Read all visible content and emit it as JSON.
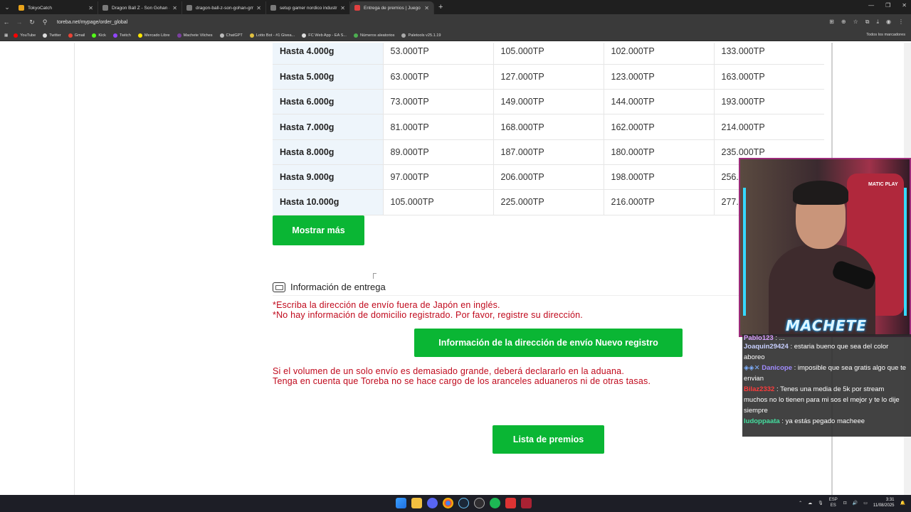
{
  "browser": {
    "tabs": [
      {
        "label": "TokyoCatch",
        "color": "#e8a31a",
        "active": false
      },
      {
        "label": "Dragon Ball Z - Son Gohan - G",
        "color": "#7a7a7a",
        "active": false
      },
      {
        "label": "dragon-ball-z-son-gohan-gm",
        "color": "#7a7a7a",
        "active": false
      },
      {
        "label": "setup gamer nordico industri",
        "color": "#7a7a7a",
        "active": false
      },
      {
        "label": "Entrega de premios | Juego de",
        "color": "#e04040",
        "active": true
      }
    ],
    "url": "toreba.net/mypage/order_global",
    "bookmarks": [
      {
        "label": "YouTube",
        "color": "#ff0000"
      },
      {
        "label": "Twitter",
        "color": "#dddddd"
      },
      {
        "label": "Gmail",
        "color": "#ea4335"
      },
      {
        "label": "Kick",
        "color": "#53fc18"
      },
      {
        "label": "Twitch",
        "color": "#9146ff"
      },
      {
        "label": "Mercado Libre",
        "color": "#ffe600"
      },
      {
        "label": "Machete Vilches",
        "color": "#7b3fa0"
      },
      {
        "label": "ChatGPT",
        "color": "#bbbbbb"
      },
      {
        "label": "Lotto Bot - #1 Givea...",
        "color": "#e0c040"
      },
      {
        "label": "FC Web App - EA S...",
        "color": "#dddddd"
      },
      {
        "label": "Números aleatorios",
        "color": "#4caf50"
      },
      {
        "label": "Paletools v25.1.19",
        "color": "#aaaaaa"
      }
    ],
    "bookmarks_right": "Todos los marcadores"
  },
  "rate_table": {
    "rows": [
      {
        "label": "Hasta 4.000g",
        "values": [
          "53.000TP",
          "105.000TP",
          "102.000TP",
          "133.000TP"
        ]
      },
      {
        "label": "Hasta 5.000g",
        "values": [
          "63.000TP",
          "127.000TP",
          "123.000TP",
          "163.000TP"
        ]
      },
      {
        "label": "Hasta 6.000g",
        "values": [
          "73.000TP",
          "149.000TP",
          "144.000TP",
          "193.000TP"
        ]
      },
      {
        "label": "Hasta 7.000g",
        "values": [
          "81.000TP",
          "168.000TP",
          "162.000TP",
          "214.000TP"
        ]
      },
      {
        "label": "Hasta 8.000g",
        "values": [
          "89.000TP",
          "187.000TP",
          "180.000TP",
          "235.000TP"
        ]
      },
      {
        "label": "Hasta 9.000g",
        "values": [
          "97.000TP",
          "206.000TP",
          "198.000TP",
          "256."
        ]
      },
      {
        "label": "Hasta 10.000g",
        "values": [
          "105.000TP",
          "225.000TP",
          "216.000TP",
          "277."
        ]
      }
    ]
  },
  "buttons": {
    "show_more": "Mostrar más",
    "new_address": "Información de la dirección de envío Nuevo registro",
    "prize_list": "Lista de premios"
  },
  "delivery": {
    "title": "Información de entrega",
    "note1": "*Escriba la dirección de envío fuera de Japón en inglés.",
    "note2": "*No hay información de domicilio registrado. Por favor, registre su dirección.",
    "customs1": "Si el volumen de un solo envío es demasiado grande, deberá declararlo en la aduana.",
    "customs2": "Tenga en cuenta que Toreba no se hace cargo de los aranceles aduaneros ni de otras tasas."
  },
  "stream": {
    "name": "MACHETE",
    "sponsor": "MATIC PLAY",
    "chat": [
      {
        "user": "Pablo123",
        "user_color": "#d9a0ff",
        "text": "...",
        "partial": true
      },
      {
        "user": "Joaquin29424",
        "user_color": "#c8d0ff",
        "text": "estaria bueno que sea del color aboreo"
      },
      {
        "user": "Danicope",
        "user_color": "#a08cff",
        "text": "imposible que sea gratis algo que te envian"
      },
      {
        "user": "Bilaz2332",
        "user_color": "#ff3b3b",
        "text": "Tenes una media de 5k por stream muchos no lo tienen para mi sos el mejor y te lo dije siempre"
      },
      {
        "user": "ludoppaata",
        "user_color": "#44e0a0",
        "text": "ya estás pegado macheee"
      }
    ]
  },
  "taskbar": {
    "lang": "ESP",
    "lang_sub": "ES",
    "time": "3:31",
    "date": "11/08/2025"
  }
}
